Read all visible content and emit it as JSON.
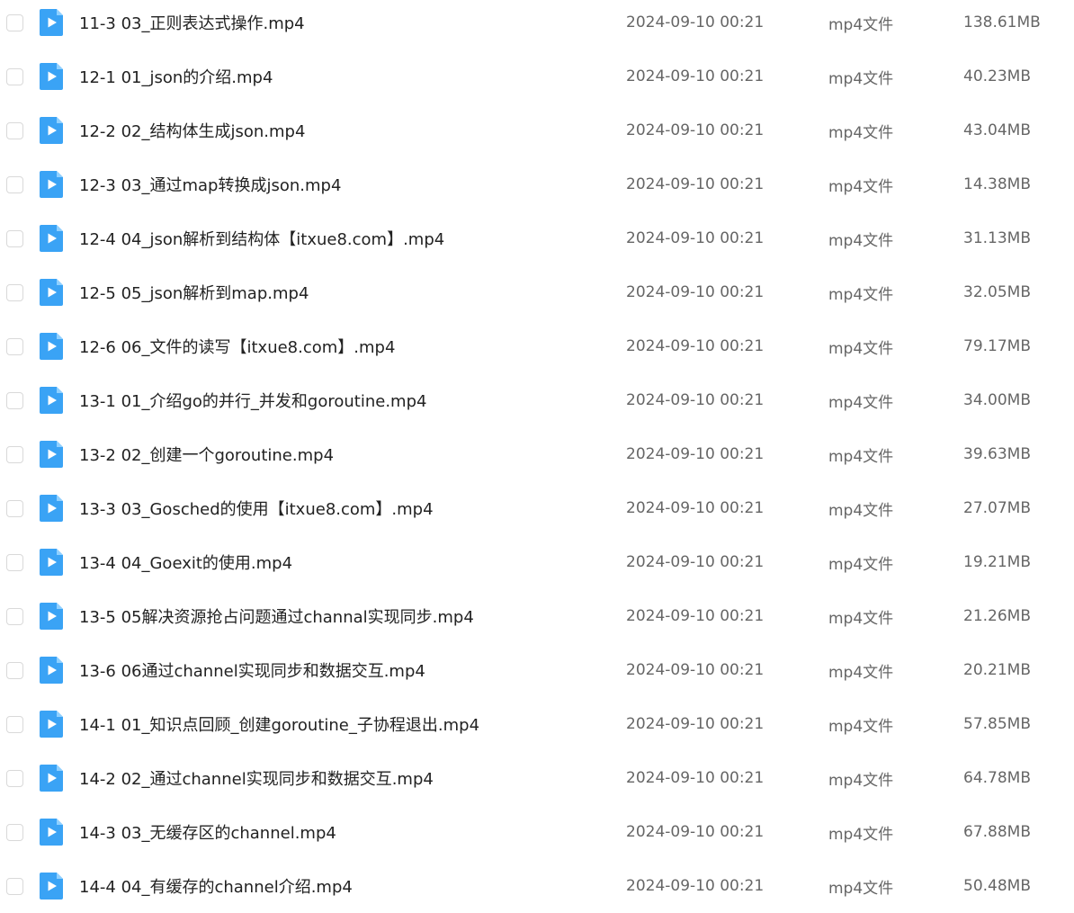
{
  "colors": {
    "icon_blue": "#3aa3f5",
    "icon_fold": "#8fd0ff",
    "text_primary": "#222222",
    "text_secondary": "#666666",
    "checkbox_border": "#d9d9d9"
  },
  "files": [
    {
      "name": "11-3 03_正则表达式操作.mp4",
      "modified": "2024-09-10 00:21",
      "type": "mp4文件",
      "size": "138.61MB",
      "icon": "video-file-icon"
    },
    {
      "name": "12-1 01_json的介绍.mp4",
      "modified": "2024-09-10 00:21",
      "type": "mp4文件",
      "size": "40.23MB",
      "icon": "video-file-icon"
    },
    {
      "name": "12-2 02_结构体生成json.mp4",
      "modified": "2024-09-10 00:21",
      "type": "mp4文件",
      "size": "43.04MB",
      "icon": "video-file-icon"
    },
    {
      "name": "12-3 03_通过map转换成json.mp4",
      "modified": "2024-09-10 00:21",
      "type": "mp4文件",
      "size": "14.38MB",
      "icon": "video-file-icon"
    },
    {
      "name": "12-4 04_json解析到结构体【itxue8.com】.mp4",
      "modified": "2024-09-10 00:21",
      "type": "mp4文件",
      "size": "31.13MB",
      "icon": "video-file-icon"
    },
    {
      "name": "12-5 05_json解析到map.mp4",
      "modified": "2024-09-10 00:21",
      "type": "mp4文件",
      "size": "32.05MB",
      "icon": "video-file-icon"
    },
    {
      "name": "12-6 06_文件的读写【itxue8.com】.mp4",
      "modified": "2024-09-10 00:21",
      "type": "mp4文件",
      "size": "79.17MB",
      "icon": "video-file-icon"
    },
    {
      "name": "13-1 01_介绍go的并行_并发和goroutine.mp4",
      "modified": "2024-09-10 00:21",
      "type": "mp4文件",
      "size": "34.00MB",
      "icon": "video-file-icon"
    },
    {
      "name": "13-2 02_创建一个goroutine.mp4",
      "modified": "2024-09-10 00:21",
      "type": "mp4文件",
      "size": "39.63MB",
      "icon": "video-file-icon"
    },
    {
      "name": "13-3 03_Gosched的使用【itxue8.com】.mp4",
      "modified": "2024-09-10 00:21",
      "type": "mp4文件",
      "size": "27.07MB",
      "icon": "video-file-icon"
    },
    {
      "name": "13-4 04_Goexit的使用.mp4",
      "modified": "2024-09-10 00:21",
      "type": "mp4文件",
      "size": "19.21MB",
      "icon": "video-file-icon"
    },
    {
      "name": "13-5 05解决资源抢占问题通过channal实现同步.mp4",
      "modified": "2024-09-10 00:21",
      "type": "mp4文件",
      "size": "21.26MB",
      "icon": "video-file-icon"
    },
    {
      "name": "13-6 06通过channel实现同步和数据交互.mp4",
      "modified": "2024-09-10 00:21",
      "type": "mp4文件",
      "size": "20.21MB",
      "icon": "video-file-icon"
    },
    {
      "name": "14-1 01_知识点回顾_创建goroutine_子协程退出.mp4",
      "modified": "2024-09-10 00:21",
      "type": "mp4文件",
      "size": "57.85MB",
      "icon": "video-file-icon"
    },
    {
      "name": "14-2 02_通过channel实现同步和数据交互.mp4",
      "modified": "2024-09-10 00:21",
      "type": "mp4文件",
      "size": "64.78MB",
      "icon": "video-file-icon"
    },
    {
      "name": "14-3 03_无缓存区的channel.mp4",
      "modified": "2024-09-10 00:21",
      "type": "mp4文件",
      "size": "67.88MB",
      "icon": "video-file-icon"
    },
    {
      "name": "14-4 04_有缓存的channel介绍.mp4",
      "modified": "2024-09-10 00:21",
      "type": "mp4文件",
      "size": "50.48MB",
      "icon": "video-file-icon"
    }
  ]
}
